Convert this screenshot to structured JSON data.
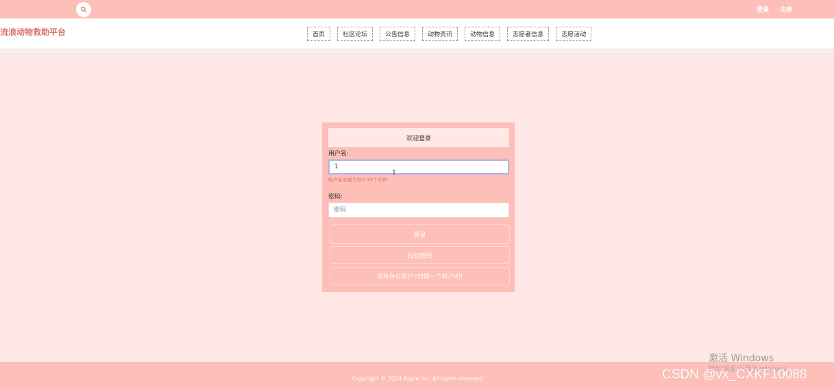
{
  "topbar": {
    "search_icon": "search-icon",
    "login_link": "登录",
    "register_link": "注册"
  },
  "header": {
    "site_title": "流浪动物救助平台",
    "nav": [
      "首页",
      "社区论坛",
      "公告信息",
      "动物资讯",
      "动物信息",
      "志愿者信息",
      "志愿活动"
    ]
  },
  "login": {
    "title": "欢迎登录",
    "username_label": "用户名:",
    "username_value": "1",
    "username_error": "账户名长度为在5-19个字符",
    "password_label": "密码:",
    "password_placeholder": "密码",
    "login_button": "登录",
    "forgot_button": "找回密码",
    "register_button": "没有存在账户?创建一个账户吧!"
  },
  "footer": {
    "copyright": "Copyright © 2024 Apple Inc. All rights reserved."
  },
  "overlay": {
    "windows_title": "激活 Windows",
    "windows_sub": "转到\"设置\"以激活 Windows。",
    "csdn_watermark": "CSDN @vx_CXKF10088"
  },
  "colors": {
    "accent": "#fdbfb8",
    "page_bg": "#ffe8e6",
    "title_color": "#d9756b"
  }
}
